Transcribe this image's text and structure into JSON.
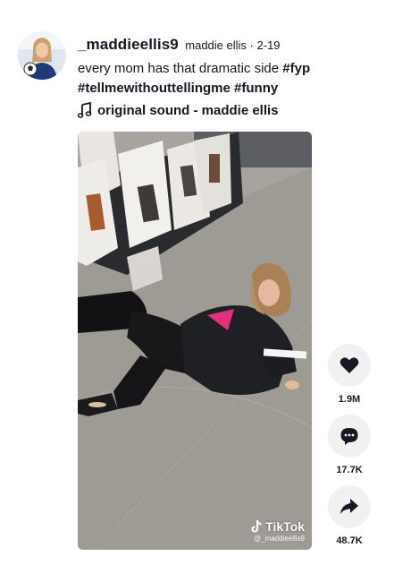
{
  "author": {
    "username": "_maddieellis9",
    "display_name": "maddie ellis",
    "separator": "·",
    "date": "2-19"
  },
  "caption": {
    "text": "every mom has that dramatic side",
    "hashtags": [
      "#fyp",
      "#tellmewithouttellingme",
      "#funny"
    ]
  },
  "music": {
    "icon": "music-note-icon",
    "label": "original sound - maddie ellis"
  },
  "video": {
    "watermark_brand": "TikTok",
    "watermark_handle": "@_maddieellis9"
  },
  "actions": {
    "like": {
      "icon": "heart-icon",
      "count": "1.9M"
    },
    "comment": {
      "icon": "comment-icon",
      "count": "17.7K"
    },
    "share": {
      "icon": "share-icon",
      "count": "48.7K"
    }
  },
  "colors": {
    "text": "#161823",
    "action_bg": "#f1f1f2",
    "background": "#ffffff"
  }
}
